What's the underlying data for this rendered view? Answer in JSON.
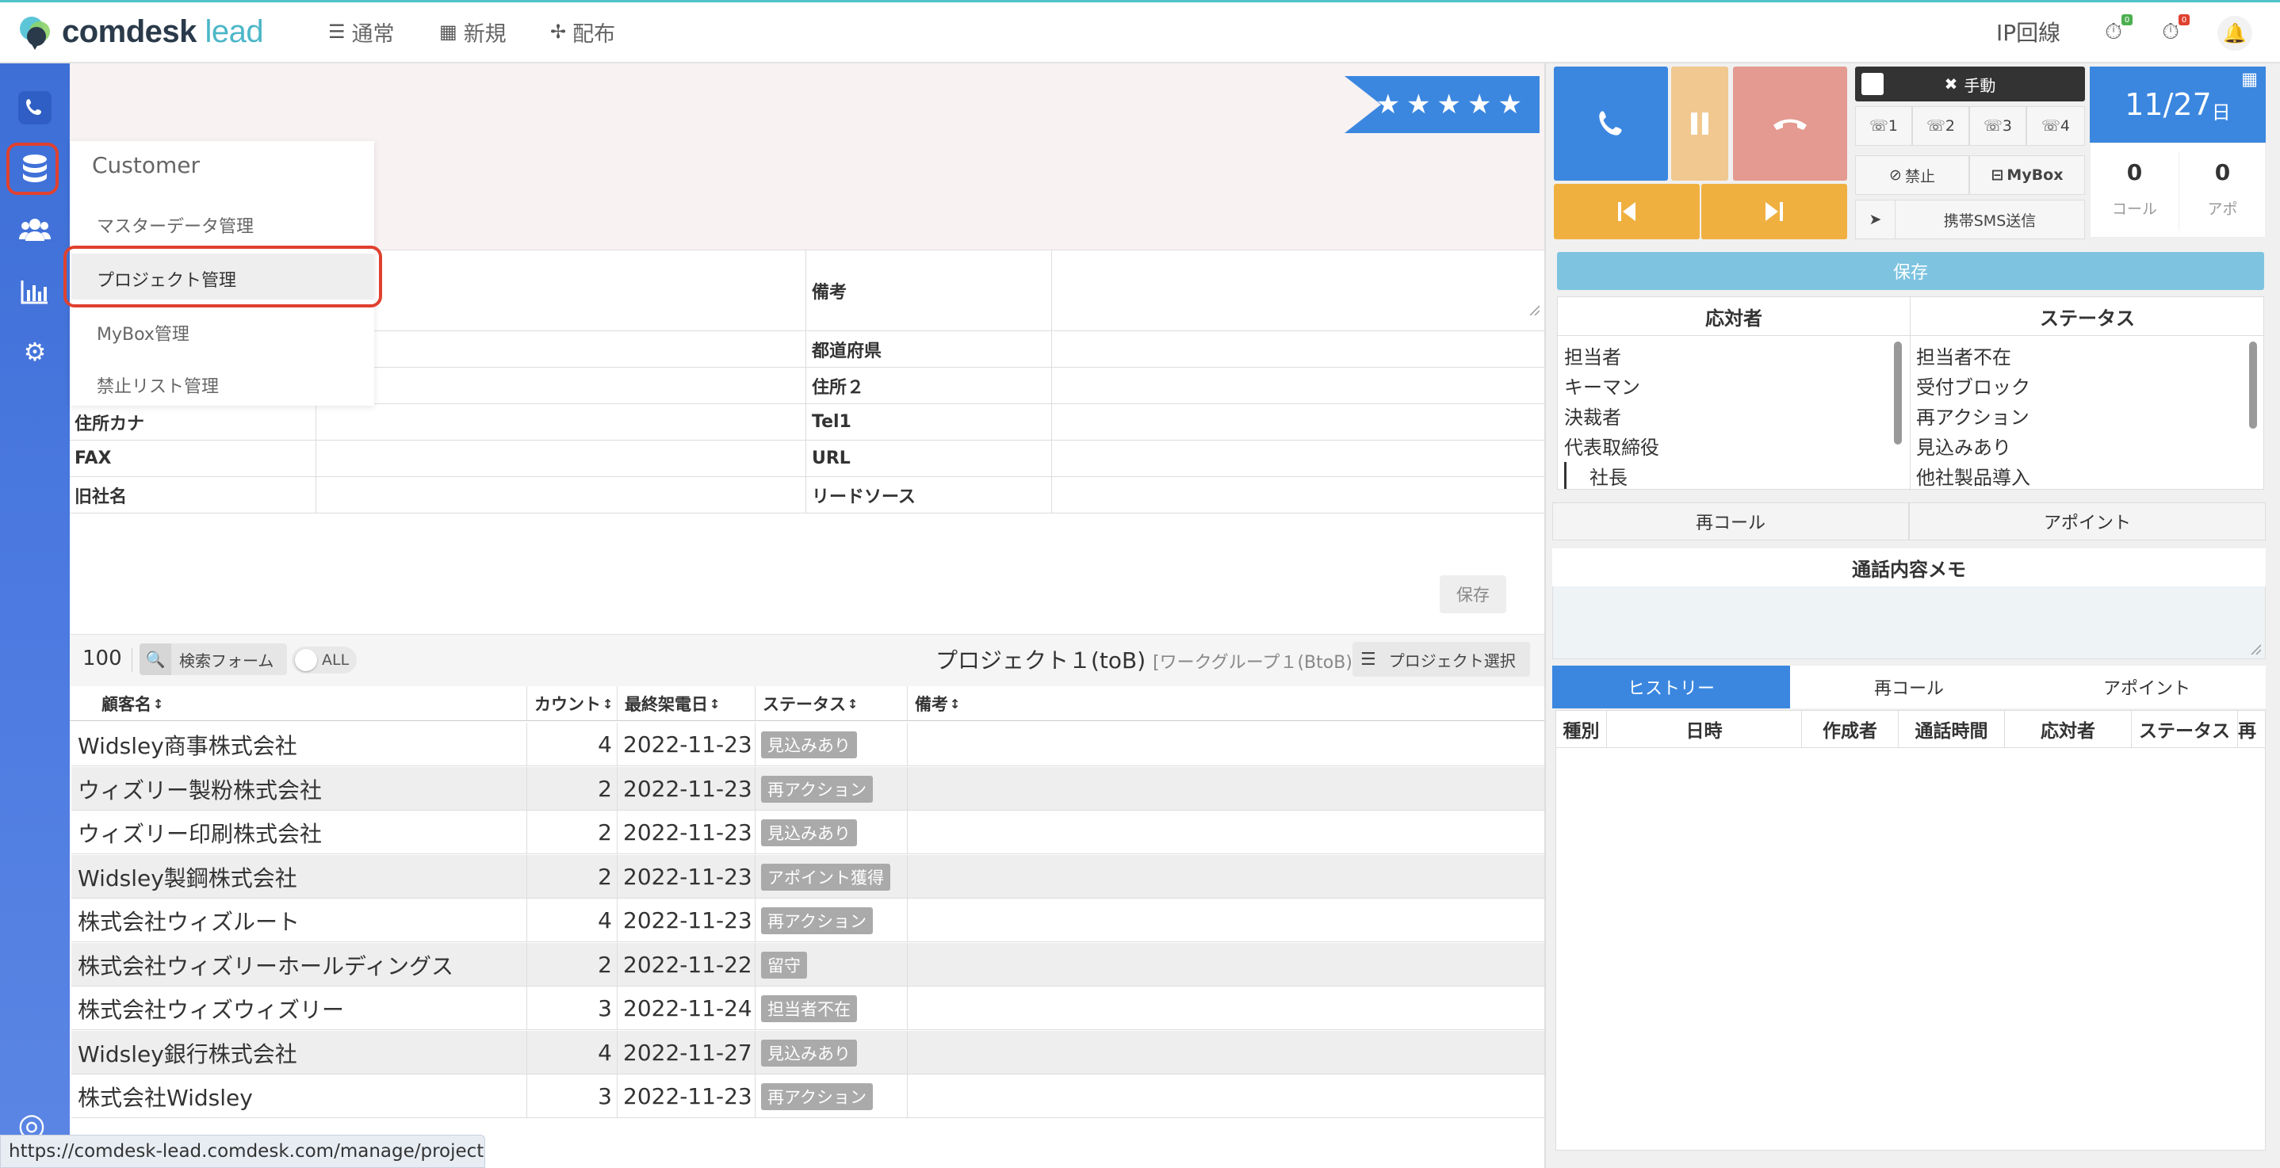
{
  "app": {
    "brand_main": "comdesk",
    "brand_sub": "lead",
    "nav": [
      {
        "label": "通常",
        "icon": "list-icon"
      },
      {
        "label": "新規",
        "icon": "grid-icon"
      },
      {
        "label": "配布",
        "icon": "distribute-icon"
      }
    ],
    "ip_line": "IP回線"
  },
  "dropdown": {
    "title": "Customer",
    "items": [
      "マスターデータ管理",
      "プロジェクト管理",
      "MyBox管理",
      "禁止リスト管理"
    ]
  },
  "rating": "★★★★★",
  "form": {
    "fields": [
      "備考",
      "都道府県",
      "住所２",
      "住所カナ",
      "Tel1",
      "FAX",
      "URL",
      "旧社名",
      "リードソース"
    ],
    "save_label": "保存"
  },
  "list": {
    "count": "100",
    "search_label": "検索フォーム",
    "toggle_label": "ALL",
    "project_title": "プロジェクト１(toB)",
    "workgroup": "[ワークグループ１(BtoB)]",
    "project_select_label": "プロジェクト選択",
    "headers": [
      "顧客名",
      "カウント",
      "最終架電日",
      "ステータス",
      "備考"
    ],
    "rows": [
      {
        "name": "Widsley商事株式会社",
        "count": "4",
        "date": "2022-11-23",
        "status": "見込みあり"
      },
      {
        "name": "ウィズリー製粉株式会社",
        "count": "2",
        "date": "2022-11-23",
        "status": "再アクション"
      },
      {
        "name": "ウィズリー印刷株式会社",
        "count": "2",
        "date": "2022-11-23",
        "status": "見込みあり"
      },
      {
        "name": "Widsley製鋼株式会社",
        "count": "2",
        "date": "2022-11-23",
        "status": "アポイント獲得"
      },
      {
        "name": "株式会社ウィズルート",
        "count": "4",
        "date": "2022-11-23",
        "status": "再アクション"
      },
      {
        "name": "株式会社ウィズリーホールディングス",
        "count": "2",
        "date": "2022-11-22",
        "status": "留守"
      },
      {
        "name": "株式会社ウィズウィズリー",
        "count": "3",
        "date": "2022-11-24",
        "status": "担当者不在"
      },
      {
        "name": "Widsley銀行株式会社",
        "count": "4",
        "date": "2022-11-27",
        "status": "見込みあり"
      },
      {
        "name": "株式会社Widsley",
        "count": "3",
        "date": "2022-11-23",
        "status": "再アクション"
      }
    ]
  },
  "status_url": "https://comdesk-lead.comdesk.com/manage/project",
  "phone": {
    "manual_label": "手動",
    "lines": [
      "1",
      "2",
      "3",
      "4"
    ],
    "ban_label": "禁止",
    "mybox_label": "MyBox",
    "sms_label": "携帯SMS送信",
    "date": "11/27",
    "date_suffix": "日",
    "call_count": "0",
    "call_label": "コール",
    "appo_count": "0",
    "appo_label": "アポ",
    "save_label": "保存",
    "respondent_header": "応対者",
    "status_header": "ステータス",
    "respondents": [
      "担当者",
      "キーマン",
      "決裁者",
      "代表取締役",
      "社長"
    ],
    "statuses": [
      "担当者不在",
      "受付ブロック",
      "再アクション",
      "見込みあり",
      "他社製品導入"
    ],
    "recall_label": "再コール",
    "appoint_label": "アポイント",
    "memo_title": "通話内容メモ",
    "tabs": [
      "ヒストリー",
      "再コール",
      "アポイント"
    ],
    "history_headers": [
      "種別",
      "日時",
      "作成者",
      "通話時間",
      "応対者",
      "ステータス",
      "再"
    ]
  },
  "colors": {
    "sidebar": "#4c7ae0",
    "call_blue": "#3b87e0",
    "pause": "#f0c890",
    "hangup": "#e49a90",
    "nav_orange": "#f0b040",
    "highlight": "#e0412f"
  }
}
